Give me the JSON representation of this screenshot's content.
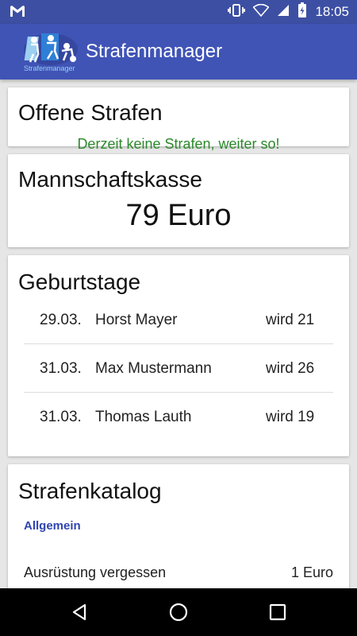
{
  "status_bar": {
    "time": "18:05",
    "icons": [
      "gmail-icon",
      "vibrate-icon",
      "wifi-icon",
      "signal-icon",
      "battery-charging-icon"
    ]
  },
  "app_bar": {
    "logo_text": "Strafenmanager",
    "title": "Strafenmanager"
  },
  "cards": {
    "offene_strafen": {
      "title": "Offene Strafen",
      "message": "Derzeit keine Strafen, weiter so!"
    },
    "mannschaftskasse": {
      "title": "Mannschaftskasse",
      "amount": "79 Euro"
    },
    "geburtstage": {
      "title": "Geburtstage",
      "rows": [
        {
          "date": "29.03.",
          "name": "Horst Mayer",
          "age": "wird 21"
        },
        {
          "date": "31.03.",
          "name": "Max Mustermann",
          "age": "wird 26"
        },
        {
          "date": "31.03.",
          "name": "Thomas Lauth",
          "age": "wird 19"
        }
      ]
    },
    "strafenkatalog": {
      "title": "Strafenkatalog",
      "section": "Allgemein",
      "items": [
        {
          "label": "Ausrüstung vergessen",
          "price": "1 Euro"
        }
      ]
    }
  },
  "nav_bar": {
    "buttons": [
      "back-icon",
      "home-icon",
      "recents-icon"
    ]
  },
  "colors": {
    "primary": "#4054b6",
    "primary_dark": "#3d4fa3",
    "success_text": "#2b8a2b",
    "section_text": "#2f45b0",
    "background": "#e6e6e6"
  }
}
